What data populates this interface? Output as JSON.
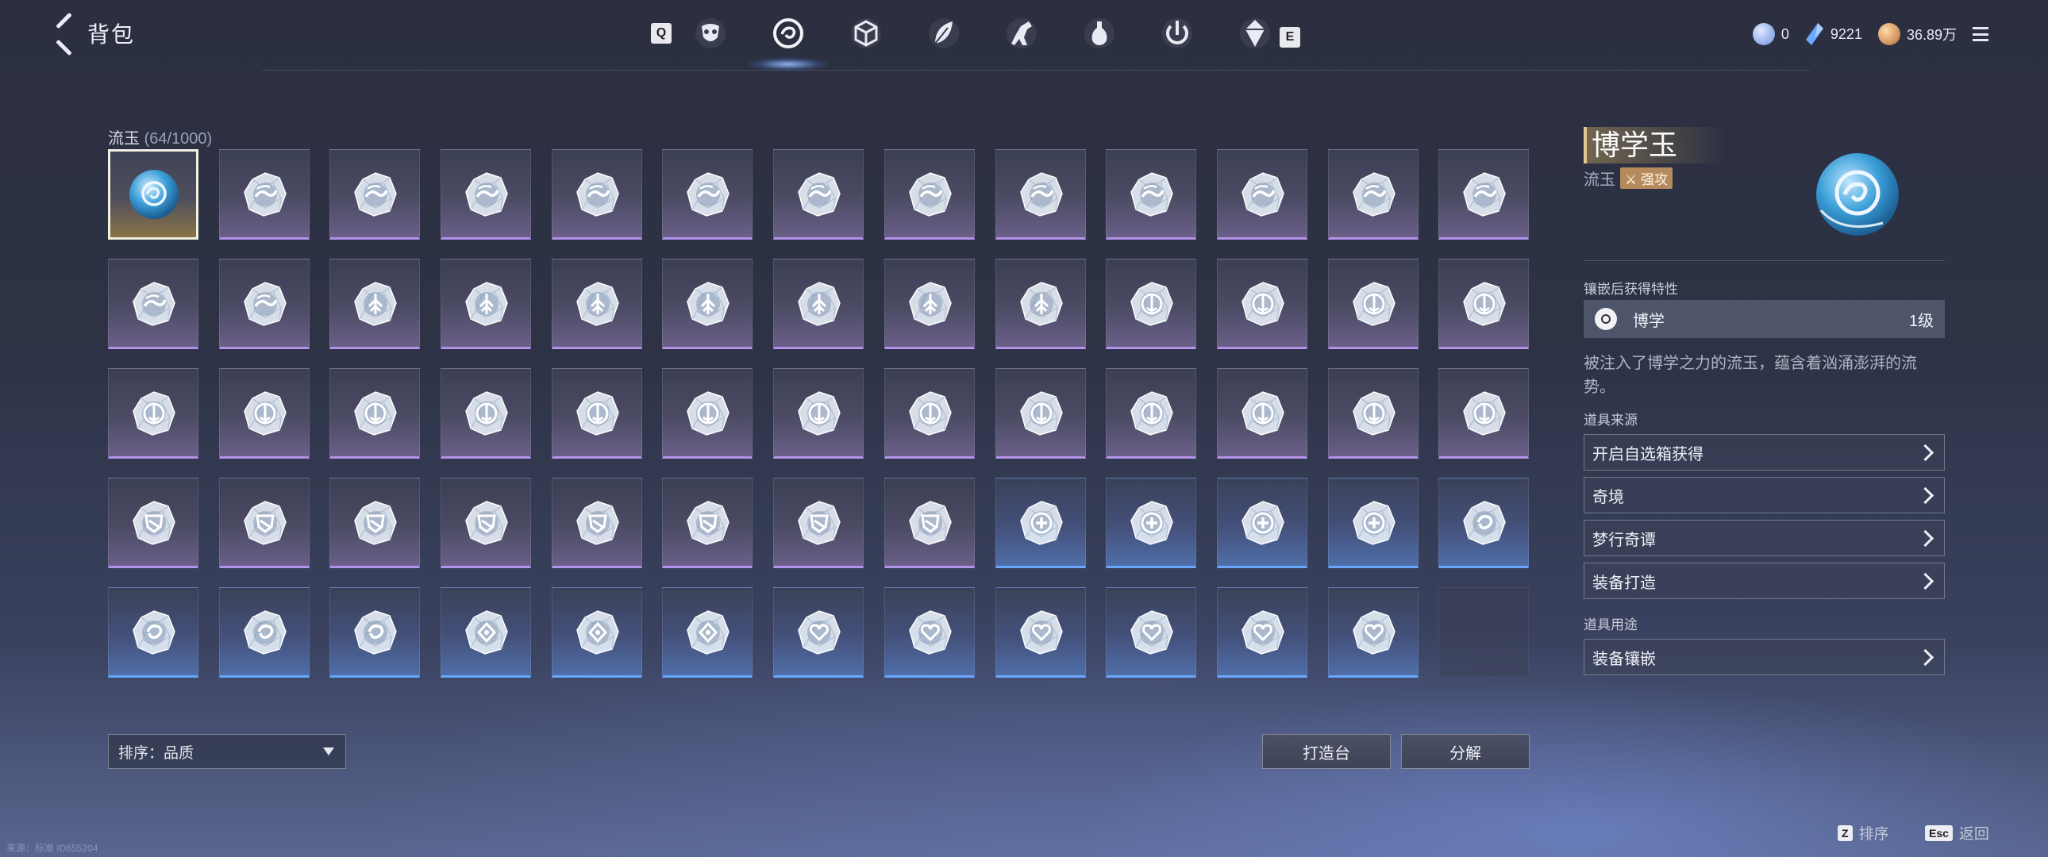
{
  "header": {
    "title": "背包",
    "tab_key_left": "Q",
    "tab_key_right": "E",
    "tabs": [
      {
        "icon": "mask-icon"
      },
      {
        "icon": "swirl-orb-icon",
        "active": true
      },
      {
        "icon": "cube-icon"
      },
      {
        "icon": "feather-icon"
      },
      {
        "icon": "horse-icon"
      },
      {
        "icon": "bottle-icon"
      },
      {
        "icon": "power-icon"
      },
      {
        "icon": "crystal-icon"
      }
    ],
    "currency": [
      {
        "icon": "moon-token-icon",
        "value": "0",
        "color": "#8fb3ff"
      },
      {
        "icon": "blue-crystal-icon",
        "value": "9221",
        "color": "#6aa8ff"
      },
      {
        "icon": "copper-coin-icon",
        "value": "36.89万",
        "color": "#d7995e"
      }
    ]
  },
  "inventory": {
    "category": "流玉",
    "count": "(64/1000)",
    "slots": [
      {
        "rarity": "gold",
        "glyph": "orb"
      },
      {
        "rarity": "purple",
        "glyph": "wave"
      },
      {
        "rarity": "purple",
        "glyph": "wave"
      },
      {
        "rarity": "purple",
        "glyph": "wave"
      },
      {
        "rarity": "purple",
        "glyph": "wave"
      },
      {
        "rarity": "purple",
        "glyph": "wave"
      },
      {
        "rarity": "purple",
        "glyph": "wave"
      },
      {
        "rarity": "purple",
        "glyph": "wave"
      },
      {
        "rarity": "purple",
        "glyph": "wave"
      },
      {
        "rarity": "purple",
        "glyph": "wave"
      },
      {
        "rarity": "purple",
        "glyph": "wave"
      },
      {
        "rarity": "purple",
        "glyph": "wave"
      },
      {
        "rarity": "purple",
        "glyph": "wave"
      },
      {
        "rarity": "purple",
        "glyph": "wave"
      },
      {
        "rarity": "purple",
        "glyph": "wave"
      },
      {
        "rarity": "purple",
        "glyph": "tree"
      },
      {
        "rarity": "purple",
        "glyph": "tree"
      },
      {
        "rarity": "purple",
        "glyph": "tree"
      },
      {
        "rarity": "purple",
        "glyph": "tree"
      },
      {
        "rarity": "purple",
        "glyph": "tree"
      },
      {
        "rarity": "purple",
        "glyph": "tree"
      },
      {
        "rarity": "purple",
        "glyph": "tree"
      },
      {
        "rarity": "purple",
        "glyph": "anchor"
      },
      {
        "rarity": "purple",
        "glyph": "anchor"
      },
      {
        "rarity": "purple",
        "glyph": "anchor"
      },
      {
        "rarity": "purple",
        "glyph": "anchor"
      },
      {
        "rarity": "purple",
        "glyph": "anchor"
      },
      {
        "rarity": "purple",
        "glyph": "anchor"
      },
      {
        "rarity": "purple",
        "glyph": "anchor"
      },
      {
        "rarity": "purple",
        "glyph": "anchor"
      },
      {
        "rarity": "purple",
        "glyph": "anchor"
      },
      {
        "rarity": "purple",
        "glyph": "anchor"
      },
      {
        "rarity": "purple",
        "glyph": "anchor"
      },
      {
        "rarity": "purple",
        "glyph": "anchor"
      },
      {
        "rarity": "purple",
        "glyph": "anchor"
      },
      {
        "rarity": "purple",
        "glyph": "anchor"
      },
      {
        "rarity": "purple",
        "glyph": "anchor"
      },
      {
        "rarity": "purple",
        "glyph": "anchor"
      },
      {
        "rarity": "purple",
        "glyph": "anchor"
      },
      {
        "rarity": "purple",
        "glyph": "shield"
      },
      {
        "rarity": "purple",
        "glyph": "shield"
      },
      {
        "rarity": "purple",
        "glyph": "shield"
      },
      {
        "rarity": "purple",
        "glyph": "shield"
      },
      {
        "rarity": "purple",
        "glyph": "shield"
      },
      {
        "rarity": "purple",
        "glyph": "shield"
      },
      {
        "rarity": "purple",
        "glyph": "shield"
      },
      {
        "rarity": "purple",
        "glyph": "shield"
      },
      {
        "rarity": "blue",
        "glyph": "plus"
      },
      {
        "rarity": "blue",
        "glyph": "plus"
      },
      {
        "rarity": "blue",
        "glyph": "plus"
      },
      {
        "rarity": "blue",
        "glyph": "plus"
      },
      {
        "rarity": "blue",
        "glyph": "swirl"
      },
      {
        "rarity": "blue",
        "glyph": "swirl"
      },
      {
        "rarity": "blue",
        "glyph": "swirl"
      },
      {
        "rarity": "blue",
        "glyph": "swirl"
      },
      {
        "rarity": "blue",
        "glyph": "diamond"
      },
      {
        "rarity": "blue",
        "glyph": "diamond"
      },
      {
        "rarity": "blue",
        "glyph": "diamond"
      },
      {
        "rarity": "blue",
        "glyph": "heart"
      },
      {
        "rarity": "blue",
        "glyph": "heart"
      },
      {
        "rarity": "blue",
        "glyph": "heart"
      },
      {
        "rarity": "blue",
        "glyph": "heart"
      },
      {
        "rarity": "blue",
        "glyph": "heart"
      },
      {
        "rarity": "blue",
        "glyph": "heart"
      },
      {
        "rarity": "empty",
        "glyph": "none"
      }
    ]
  },
  "controls": {
    "sort_label": "排序：品质",
    "forge_label": "打造台",
    "split_label": "分解"
  },
  "detail": {
    "name": "博学玉",
    "type": "流玉",
    "tag": "强攻",
    "trait_section": "镶嵌后获得特性",
    "trait_name": "博学",
    "trait_level": "1级",
    "description": "被注入了博学之力的流玉，蕴含着汹涌澎湃的流势。",
    "source_section": "道具来源",
    "sources": [
      "开启自选箱获得",
      "奇境",
      "梦行奇谭",
      "装备打造"
    ],
    "use_section": "道具用途",
    "uses": [
      "装备镶嵌"
    ]
  },
  "footer": {
    "sort_key": "Z",
    "sort_hint": "排序",
    "back_key": "Esc",
    "back_hint": "返回",
    "watermark": "来源：标准 ID655204"
  }
}
